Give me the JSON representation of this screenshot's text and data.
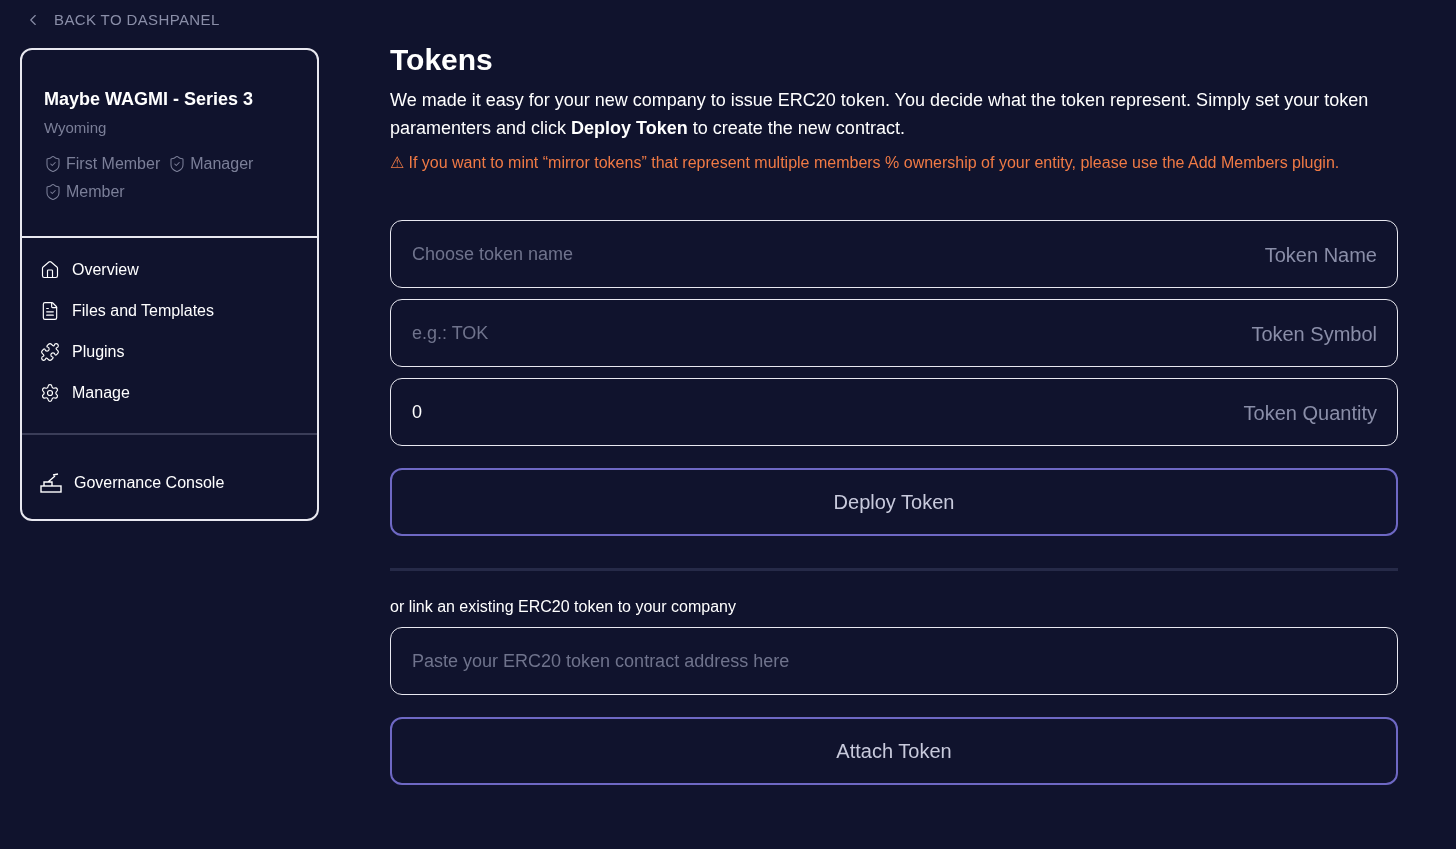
{
  "back_link": {
    "label": "BACK TO DASHPANEL"
  },
  "entity": {
    "name": "Maybe WAGMI - Series 3",
    "jurisdiction": "Wyoming",
    "roles": [
      "First Member",
      "Manager",
      "Member"
    ]
  },
  "nav": {
    "items": [
      {
        "label": "Overview"
      },
      {
        "label": "Files and Templates"
      },
      {
        "label": "Plugins"
      },
      {
        "label": "Manage"
      }
    ],
    "footer_item": {
      "label": "Governance Console"
    }
  },
  "page": {
    "title": "Tokens",
    "intro": "We made it easy for your new company to issue ERC20 token. You decide what the token represent. Simply set your token paramenters and click **Deploy Token** to create the new contract.",
    "warning": {
      "icon": "⚠",
      "text": "If you want to mint “mirror tokens” that represent multiple members % ownership of your entity, please use the Add Members plugin."
    },
    "fields": [
      {
        "placeholder": "Choose token name",
        "label": "Token Name"
      },
      {
        "placeholder": "e.g.: TOK",
        "label": "Token Symbol"
      },
      {
        "value": "0",
        "label": "Token Quantity"
      }
    ],
    "deploy_button": "Deploy Token",
    "link_label": "or link an existing ERC20 token to your company",
    "address_field": {
      "placeholder": "Paste your ERC20 token contract address here"
    },
    "attach_button": "Attach Token"
  }
}
